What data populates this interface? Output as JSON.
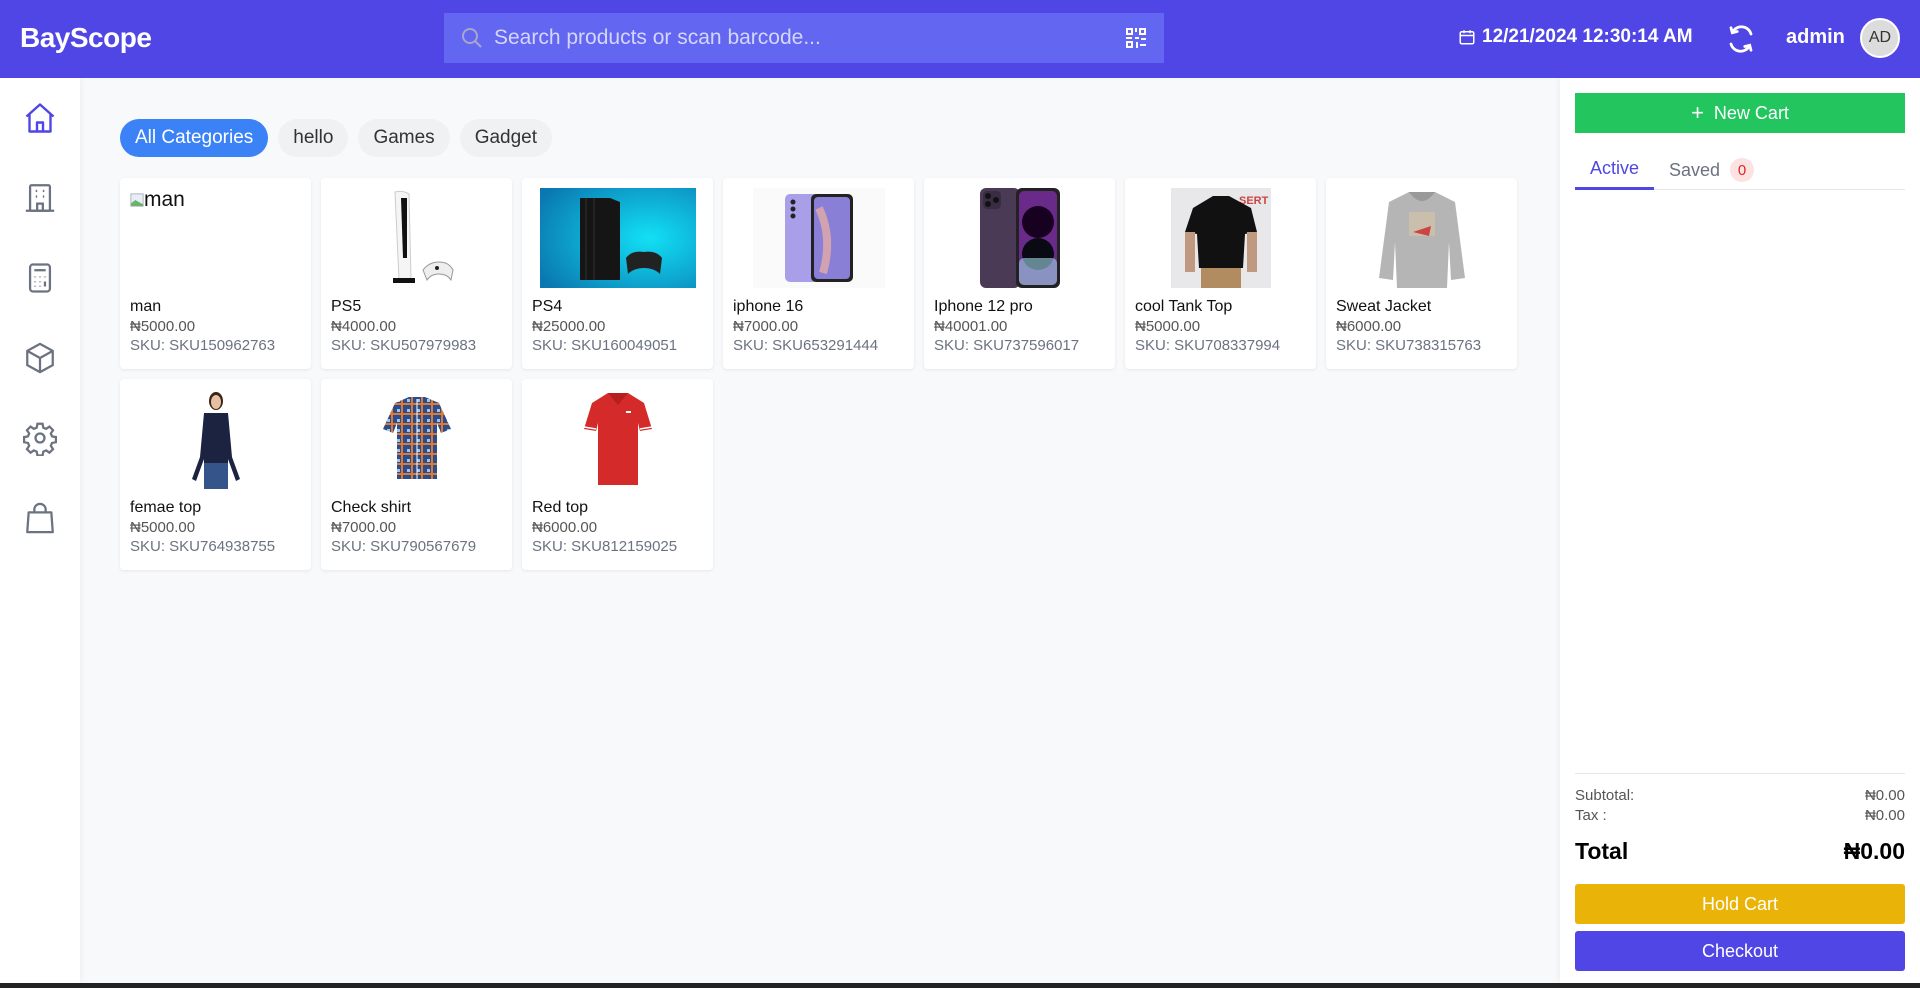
{
  "header": {
    "logo": "BayScope",
    "search_placeholder": "Search products or scan barcode...",
    "search_value": "",
    "datetime": "12/21/2024 12:30:14 AM",
    "username": "admin",
    "avatar_initials": "AD",
    "colors": {
      "brand": "#4f46e5",
      "search_bg": "#6366f1"
    }
  },
  "sidebar": {
    "items": [
      {
        "name": "home",
        "icon": "home-icon",
        "active": true
      },
      {
        "name": "building",
        "icon": "building-icon",
        "active": false
      },
      {
        "name": "calculator",
        "icon": "calculator-icon",
        "active": false
      },
      {
        "name": "products",
        "icon": "box-icon",
        "active": false
      },
      {
        "name": "settings",
        "icon": "gear-icon",
        "active": false
      },
      {
        "name": "orders",
        "icon": "shopping-bag-icon",
        "active": false
      }
    ]
  },
  "categories": [
    {
      "label": "All Categories",
      "active": true
    },
    {
      "label": "hello",
      "active": false
    },
    {
      "label": "Games",
      "active": false
    },
    {
      "label": "Gadget",
      "active": false
    }
  ],
  "products": [
    {
      "name": "man",
      "price": "₦5000.00",
      "sku": "SKU: SKU150962763",
      "image": "broken",
      "alt": "man"
    },
    {
      "name": "PS5",
      "price": "₦4000.00",
      "sku": "SKU: SKU507979983",
      "image": "ps5"
    },
    {
      "name": "PS4",
      "price": "₦25000.00",
      "sku": "SKU: SKU160049051",
      "image": "ps4"
    },
    {
      "name": "iphone 16",
      "price": "₦7000.00",
      "sku": "SKU: SKU653291444",
      "image": "phone-purple"
    },
    {
      "name": "Iphone 12 pro",
      "price": "₦40001.00",
      "sku": "SKU: SKU737596017",
      "image": "iphone-pro"
    },
    {
      "name": "cool Tank Top",
      "price": "₦5000.00",
      "sku": "SKU: SKU708337994",
      "image": "black-tee"
    },
    {
      "name": "Sweat Jacket",
      "price": "₦6000.00",
      "sku": "SKU: SKU738315763",
      "image": "hoodie"
    },
    {
      "name": "femae top",
      "price": "₦5000.00",
      "sku": "SKU: SKU764938755",
      "image": "female-top"
    },
    {
      "name": "Check shirt",
      "price": "₦7000.00",
      "sku": "SKU: SKU790567679",
      "image": "check-shirt"
    },
    {
      "name": "Red top",
      "price": "₦6000.00",
      "sku": "SKU: SKU812159025",
      "image": "red-polo"
    }
  ],
  "cart": {
    "new_cart_label": "New Cart",
    "tabs": [
      {
        "label": "Active",
        "active": true
      },
      {
        "label": "Saved",
        "active": false,
        "badge": "0"
      }
    ],
    "subtotal_label": "Subtotal:",
    "subtotal_value": "₦0.00",
    "tax_label": "Tax :",
    "tax_value": "₦0.00",
    "total_label": "Total",
    "total_value": "₦0.00",
    "hold_label": "Hold Cart",
    "checkout_label": "Checkout",
    "colors": {
      "new_cart": "#22c55e",
      "hold": "#eab308",
      "checkout": "#4f46e5"
    }
  }
}
